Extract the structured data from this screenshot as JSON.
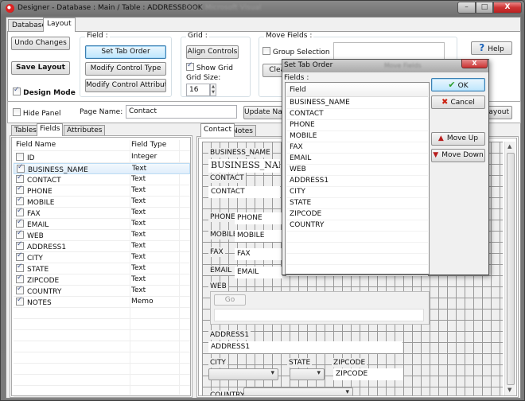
{
  "window": {
    "title": "Designer - Database : Main / Table : ADDRESSBOOK",
    "background_title": "C:\\...\\ Microsoft Visual",
    "minimize": "–",
    "maximize": "□",
    "close": "X"
  },
  "ribbon": {
    "tabs": [
      {
        "label": "Database",
        "active": false
      },
      {
        "label": "Layout",
        "active": true
      }
    ],
    "undo_label": "Undo Changes",
    "save_label": "Save Layout",
    "design_mode_label": "Design Mode",
    "design_mode_checked": true,
    "field_group": {
      "label": "Field :",
      "set_tab_order": "Set Tab Order",
      "modify_control_type": "Modify Control Type",
      "modify_control_attributes": "Modify Control Attributes"
    },
    "grid_group": {
      "label": "Grid :",
      "align_controls": "Align Controls",
      "show_grid_label": "Show Grid",
      "show_grid_checked": true,
      "grid_size_label": "Grid Size:",
      "grid_size_value": "16"
    },
    "move_group": {
      "label": "Move Fields :",
      "group_selection_label": "Group Selection",
      "group_selection_checked": false,
      "clear_label": "Clear"
    },
    "help_label": "Help"
  },
  "panelbar": {
    "hide_panel_label": "Hide Panel",
    "hide_panel_checked": false,
    "page_name_label": "Page Name:",
    "page_name_value": "Contact",
    "update_name_label": "Update Name",
    "layout_button_label": "Layout"
  },
  "left_panel": {
    "tabs": [
      {
        "label": "Tables",
        "active": false
      },
      {
        "label": "Fields",
        "active": true
      },
      {
        "label": "Attributes",
        "active": false
      }
    ],
    "columns": [
      "Field Name",
      "Field Type"
    ],
    "rows": [
      {
        "name": "ID",
        "type": "Integer",
        "checked": false
      },
      {
        "name": "BUSINESS_NAME",
        "type": "Text",
        "checked": true,
        "selected": true
      },
      {
        "name": "CONTACT",
        "type": "Text",
        "checked": true
      },
      {
        "name": "PHONE",
        "type": "Text",
        "checked": true
      },
      {
        "name": "MOBILE",
        "type": "Text",
        "checked": true
      },
      {
        "name": "FAX",
        "type": "Text",
        "checked": true
      },
      {
        "name": "EMAIL",
        "type": "Text",
        "checked": true
      },
      {
        "name": "WEB",
        "type": "Text",
        "checked": true
      },
      {
        "name": "ADDRESS1",
        "type": "Text",
        "checked": true
      },
      {
        "name": "CITY",
        "type": "Text",
        "checked": true
      },
      {
        "name": "STATE",
        "type": "Text",
        "checked": true
      },
      {
        "name": "ZIPCODE",
        "type": "Text",
        "checked": true
      },
      {
        "name": "COUNTRY",
        "type": "Text",
        "checked": true
      },
      {
        "name": "NOTES",
        "type": "Memo",
        "checked": true
      }
    ]
  },
  "designer": {
    "tabs": [
      {
        "label": "Contact",
        "active": true
      },
      {
        "label": "Notes",
        "active": false
      }
    ],
    "controls": {
      "business_name_label": "BUSINESS_NAME",
      "business_name_field": "BUSINESS_NAME",
      "contact_label": "CONTACT",
      "contact_field": "CONTACT",
      "phone_label": "PHONE",
      "phone_field": "PHONE",
      "mobile_label": "MOBILE",
      "mobile_field": "MOBILE",
      "fax_label": "FAX",
      "fax_field": "FAX",
      "email_label": "EMAIL",
      "email_field": "EMAIL",
      "web_label": "WEB",
      "go_button": "Go",
      "address1_label": "ADDRESS1",
      "address1_field": "ADDRESS1",
      "city_label": "CITY",
      "state_label": "STATE",
      "zipcode_label": "ZIPCODE",
      "zipcode_field": "ZIPCODE",
      "country_label": "COUNTRY"
    }
  },
  "dialog": {
    "title": "Set Tab Order",
    "background_title": "Move Fields",
    "close": "X",
    "fields_label": "Fields :",
    "column": "Field",
    "items": [
      "BUSINESS_NAME",
      "CONTACT",
      "PHONE",
      "MOBILE",
      "FAX",
      "EMAIL",
      "WEB",
      "ADDRESS1",
      "CITY",
      "STATE",
      "ZIPCODE",
      "COUNTRY"
    ],
    "ok_label": "OK",
    "cancel_label": "Cancel",
    "move_up_label": "Move Up",
    "move_down_label": "Move Down"
  }
}
